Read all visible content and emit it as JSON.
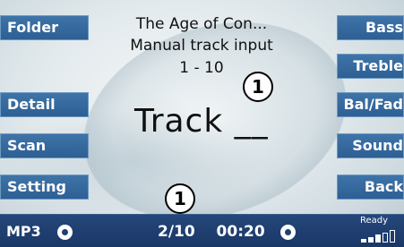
{
  "left_buttons": [
    {
      "label": "Folder"
    },
    {
      "label": "Detail"
    },
    {
      "label": "Scan"
    },
    {
      "label": "Setting"
    }
  ],
  "right_buttons": [
    {
      "label": "Bass"
    },
    {
      "label": "Treble"
    },
    {
      "label": "Bal/Fad"
    },
    {
      "label": "Sound"
    },
    {
      "label": "Back"
    }
  ],
  "display": {
    "title": "The Age of Con...",
    "subtitle": "Manual track input",
    "range": "1 - 10",
    "track_prompt": "Track __"
  },
  "callouts": {
    "top": "1",
    "bottom": "1"
  },
  "status": {
    "source": "MP3",
    "track_position": "2/10",
    "elapsed": "00:20",
    "ready": "Ready",
    "signal_level": 3,
    "signal_max": 5
  },
  "colors": {
    "button": "#2d5f94",
    "status_bar": "#1a3766",
    "text_on_button": "#ffffff"
  },
  "icons": [
    "disc-icon",
    "signal-strength-icon"
  ]
}
